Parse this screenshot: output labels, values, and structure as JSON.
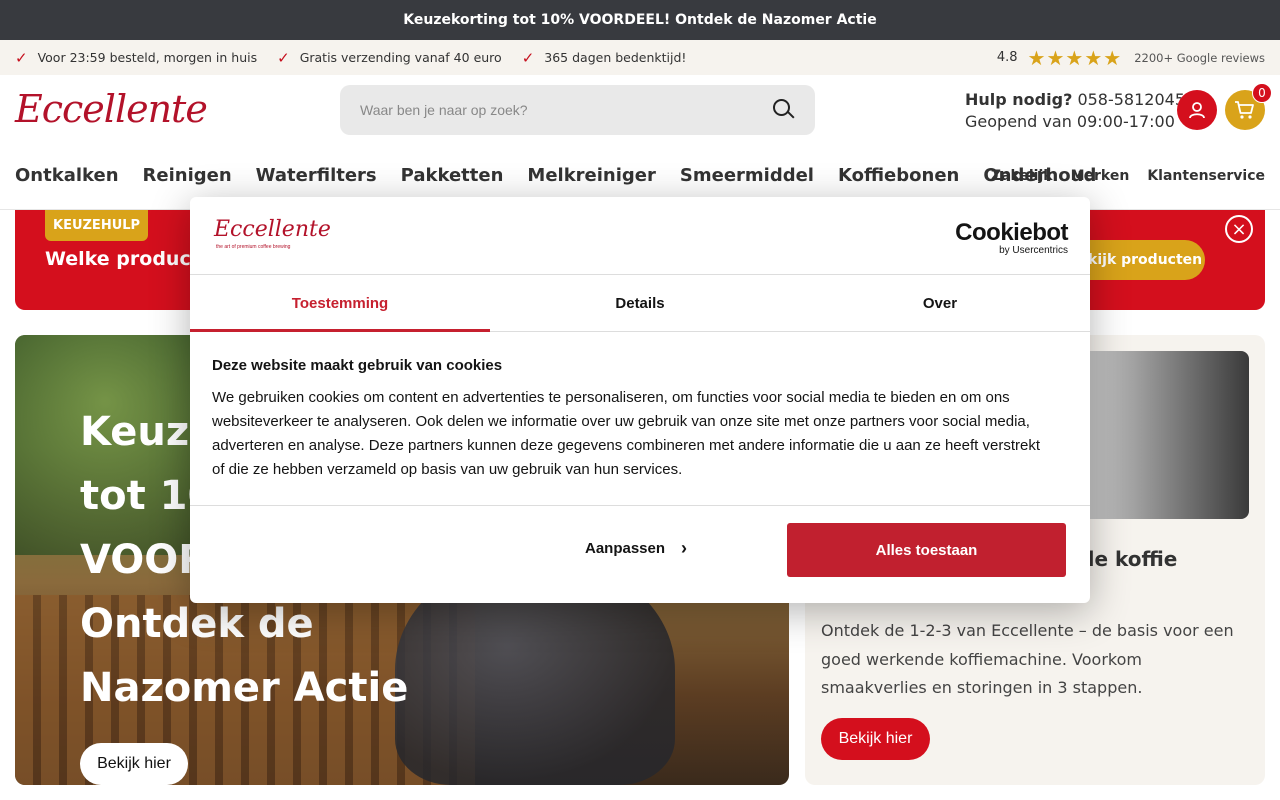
{
  "topbar": {
    "text": "Keuzekorting tot 10% VOORDEEL! Ontdek de Nazomer Actie"
  },
  "usps": [
    {
      "label": "Voor 23:59 besteld, morgen in huis"
    },
    {
      "label": "Gratis verzending vanaf 40 euro"
    },
    {
      "label": "365 dagen bedenktijd!"
    }
  ],
  "reviews": {
    "score": "4.8",
    "stars": 5,
    "count": "2200+ Google reviews"
  },
  "header": {
    "logo": "Eccellente",
    "search_placeholder": "Waar ben je naar op zoek?",
    "help_title": "Hulp nodig?",
    "help_phone": "058-5812045",
    "help_hours": "Geopend van 09:00-17:00",
    "cart_count": "0"
  },
  "nav": {
    "items": [
      "Ontkalken",
      "Reinigen",
      "Waterfilters",
      "Pakketten",
      "Melkreiniger",
      "Smeermiddel",
      "Koffiebonen",
      "Onderhoud"
    ],
    "right_items": [
      "Zakelijk",
      "Merken",
      "Klantenservice"
    ]
  },
  "keuze_banner": {
    "tag": "KEUZEHULP",
    "title": "Welke producten",
    "button": "Bekijk producten",
    "close": "×"
  },
  "hero": {
    "lines": [
      "Keuzekorting",
      "tot 10%",
      "VOORDEEL!",
      "Ontdek de",
      "Nazomer Actie"
    ],
    "button": "Bekijk hier"
  },
  "side_card": {
    "title": "De basis voor smaakvolle koffie",
    "text": "Ontdek de 1-2-3 van Eccellente – de basis voor een goed werkende koffiemachine. Voorkom smaakverlies en storingen in 3 stappen.",
    "button": "Bekijk hier"
  },
  "cookie_dialog": {
    "logo": "Eccellente",
    "logo_sub": "the art of premium coffee brewing",
    "brand": "Cookiebot",
    "brand_sub": "by Usercentrics",
    "tabs": [
      "Toestemming",
      "Details",
      "Over"
    ],
    "active_tab": "Toestemming",
    "heading": "Deze website maakt gebruik van cookies",
    "body": "We gebruiken cookies om content en advertenties te personaliseren, om functies voor social media te bieden en om ons websiteverkeer te analyseren. Ook delen we informatie over uw gebruik van onze site met onze partners voor social media, adverteren en analyse. Deze partners kunnen deze gegevens combineren met andere informatie die u aan ze heeft verstrekt of die ze hebben verzameld op basis van uw gebruik van hun services.",
    "customize_label": "Aanpassen",
    "allow_all_label": "Alles toestaan"
  },
  "colors": {
    "brand_red": "#d40f1d",
    "gold": "#d9a31a",
    "cookie_red": "#c1202f",
    "topbar": "#383a3f"
  }
}
